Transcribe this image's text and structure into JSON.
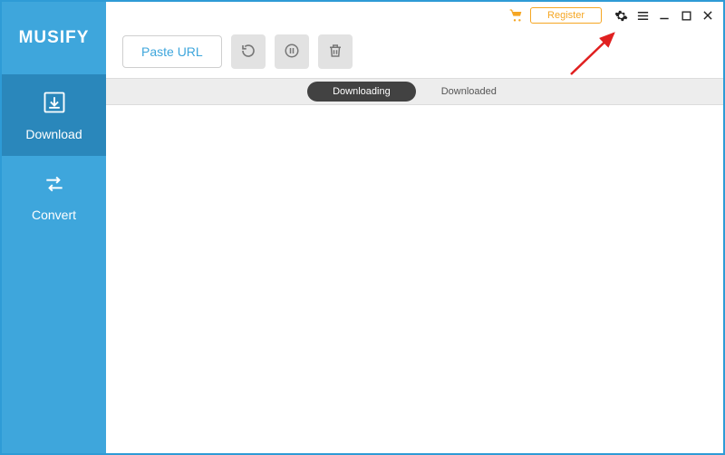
{
  "app": {
    "name": "MUSIFY"
  },
  "sidebar": {
    "items": [
      {
        "label": "Download",
        "icon": "download-icon",
        "active": true
      },
      {
        "label": "Convert",
        "icon": "convert-icon",
        "active": false
      }
    ]
  },
  "titlebar": {
    "register_label": "Register"
  },
  "toolbar": {
    "paste_label": "Paste URL"
  },
  "tabs": {
    "downloading_label": "Downloading",
    "downloaded_label": "Downloaded"
  },
  "annotation": {
    "arrow_color": "#E02020"
  }
}
